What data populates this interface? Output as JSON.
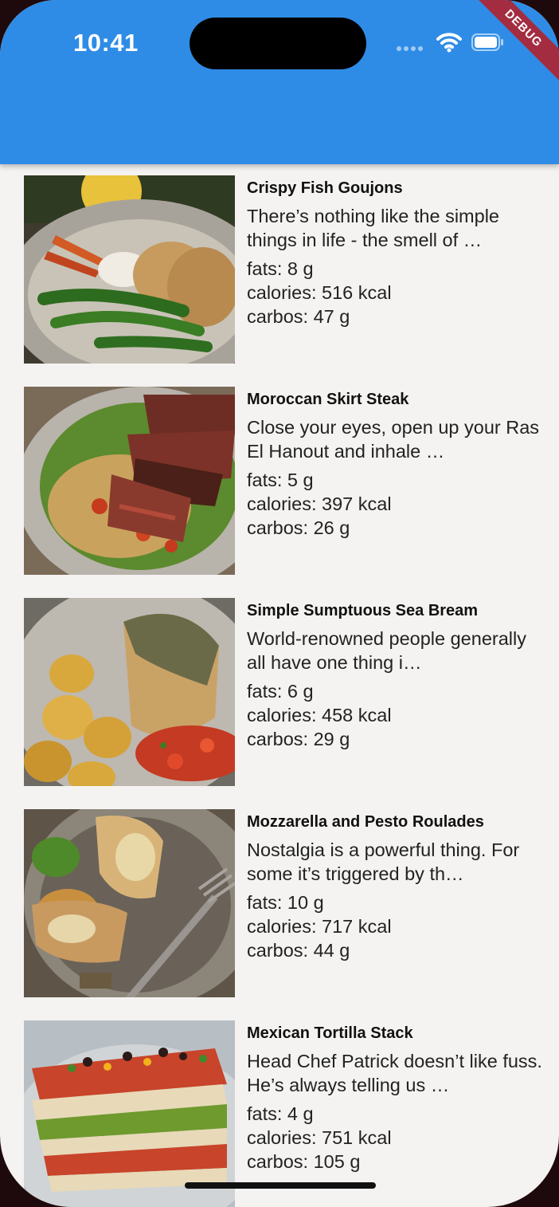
{
  "status_bar": {
    "time": "10:41",
    "debug_label": "DEBUG"
  },
  "colors": {
    "app_bar": "#2f8ce6",
    "background": "#f4f3f1",
    "debug_banner": "#a32c40"
  },
  "recipes": [
    {
      "title": "Crispy Fish Goujons",
      "description": "There’s nothing like the simple things in life - the smell of …",
      "fats": "fats: 8 g",
      "calories": "calories: 516 kcal",
      "carbos": "carbos: 47 g",
      "image": "crispy-fish-goujons-photo"
    },
    {
      "title": "Moroccan Skirt Steak",
      "description": "Close your eyes, open up your Ras El Hanout and inhale …",
      "fats": "fats: 5 g",
      "calories": "calories: 397 kcal",
      "carbos": "carbos: 26 g",
      "image": "moroccan-skirt-steak-photo"
    },
    {
      "title": "Simple Sumptuous Sea Bream",
      "description": "World-renowned people generally all have one thing i…",
      "fats": "fats: 6 g",
      "calories": "calories: 458 kcal",
      "carbos": "carbos: 29 g",
      "image": "sea-bream-photo"
    },
    {
      "title": "Mozzarella and Pesto Roulades",
      "description": "Nostalgia is a powerful thing. For some it’s triggered by th…",
      "fats": "fats: 10 g",
      "calories": "calories: 717 kcal",
      "carbos": "carbos: 44 g",
      "image": "mozzarella-pesto-roulades-photo"
    },
    {
      "title": "Mexican Tortilla Stack",
      "description": "Head Chef Patrick doesn’t like fuss. He’s always telling us …",
      "fats": "fats: 4 g",
      "calories": "calories: 751 kcal",
      "carbos": "carbos: 105 g",
      "image": "mexican-tortilla-stack-photo"
    }
  ]
}
